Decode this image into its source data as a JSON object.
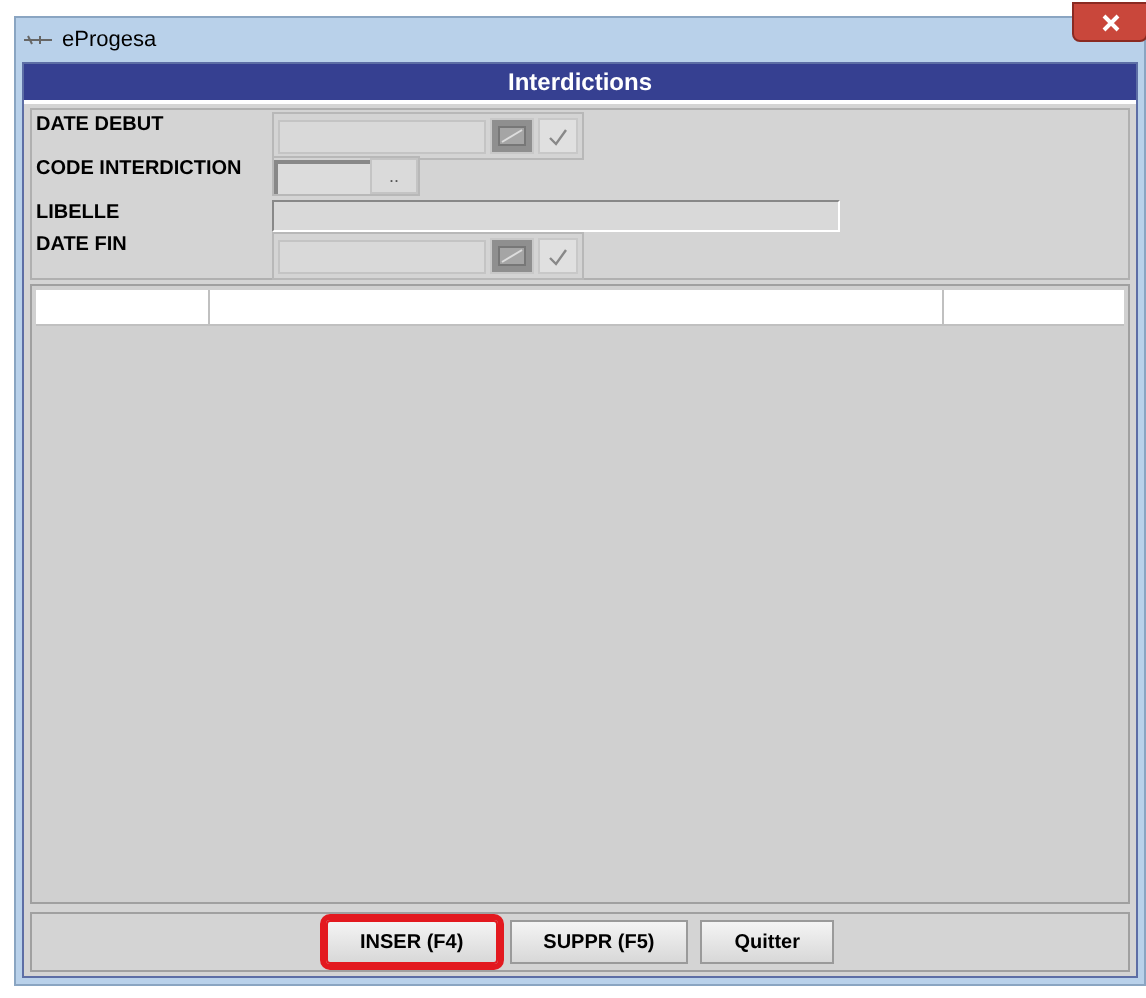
{
  "window": {
    "title": "eProgesa"
  },
  "header": {
    "title": "Interdictions"
  },
  "form": {
    "fields": [
      {
        "kind": "date",
        "label": "DATE DEBUT"
      },
      {
        "kind": "code",
        "label": "CODE INTERDICTION",
        "button": ".."
      },
      {
        "kind": "text",
        "label": "LIBELLE"
      },
      {
        "kind": "date",
        "label": "DATE FIN"
      }
    ]
  },
  "buttons": [
    {
      "label": "INSER (F4)",
      "highlighted": true
    },
    {
      "label": "SUPPR (F5)",
      "highlighted": false
    },
    {
      "label": "Quitter",
      "highlighted": false
    }
  ]
}
